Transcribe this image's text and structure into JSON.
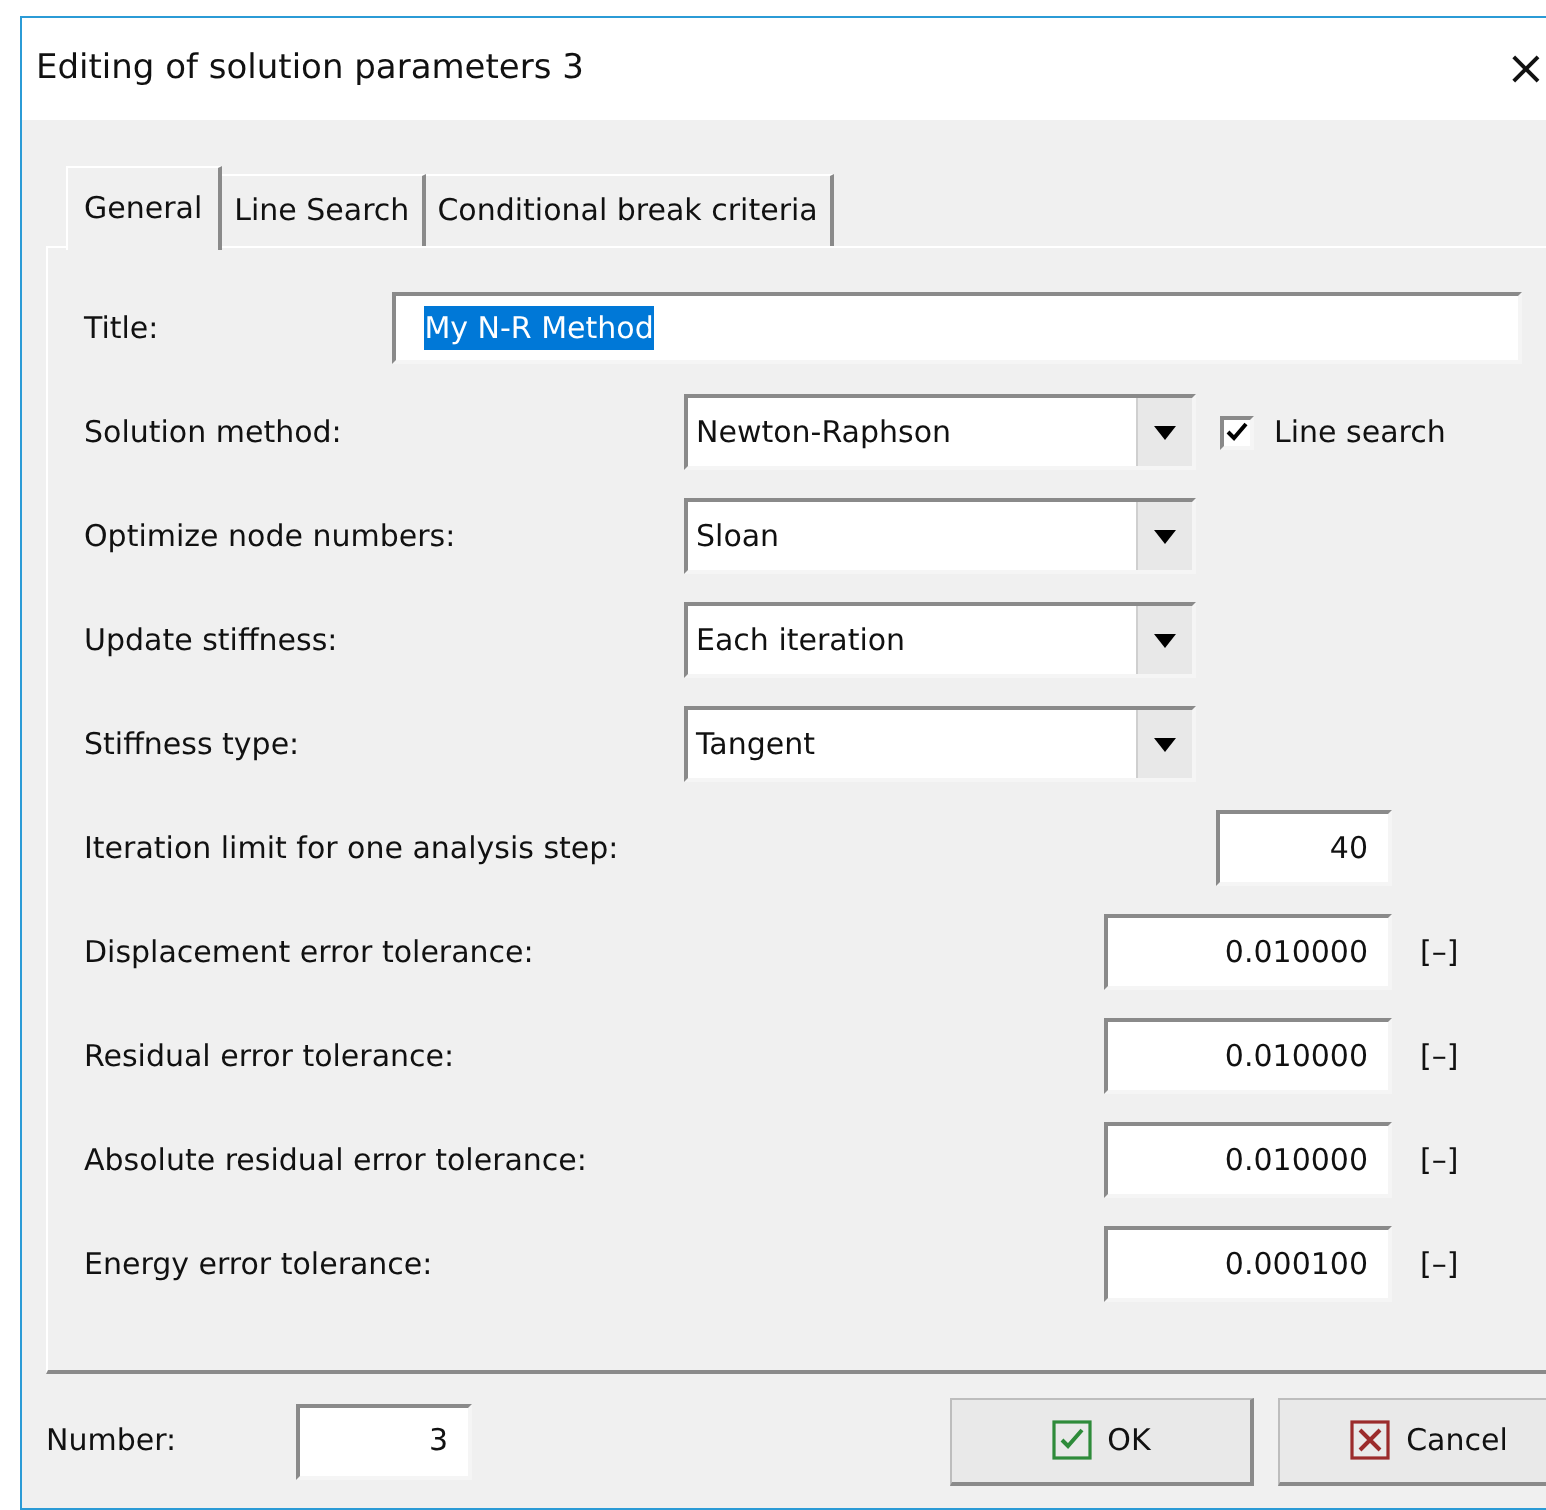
{
  "window": {
    "title": "Editing of solution parameters 3",
    "close": "×"
  },
  "tabs": [
    {
      "label": "General",
      "selected": true
    },
    {
      "label": "Line Search",
      "selected": false
    },
    {
      "label": "Conditional break criteria",
      "selected": false
    }
  ],
  "title_field": {
    "label": "Title:",
    "value": "My N-R Method",
    "value_selected": true
  },
  "combos": [
    {
      "label": "Solution method:",
      "value": "Newton-Raphson",
      "checkbox": {
        "label": "Line search",
        "checked": true
      }
    },
    {
      "label": "Optimize node numbers:",
      "value": "Sloan"
    },
    {
      "label": "Update stiffness:",
      "value": "Each iteration"
    },
    {
      "label": "Stiffness type:",
      "value": "Tangent"
    }
  ],
  "numeric_fields": [
    {
      "label": "Iteration limit for one analysis step:",
      "value": "40",
      "kind": "short"
    },
    {
      "label": "Displacement error tolerance:",
      "value": "0.010000",
      "unit": "[–]",
      "kind": "wide"
    },
    {
      "label": "Residual error tolerance:",
      "value": "0.010000",
      "unit": "[–]",
      "kind": "wide"
    },
    {
      "label": "Absolute residual error tolerance:",
      "value": "0.010000",
      "unit": "[–]",
      "kind": "wide"
    },
    {
      "label": "Energy error tolerance:",
      "value": "0.000100",
      "unit": "[–]",
      "kind": "wide"
    }
  ],
  "number": {
    "label": "Number:",
    "value": "3"
  },
  "buttons": [
    {
      "label": "OK",
      "kind": "ok"
    },
    {
      "label": "Cancel",
      "kind": "cancel"
    }
  ]
}
